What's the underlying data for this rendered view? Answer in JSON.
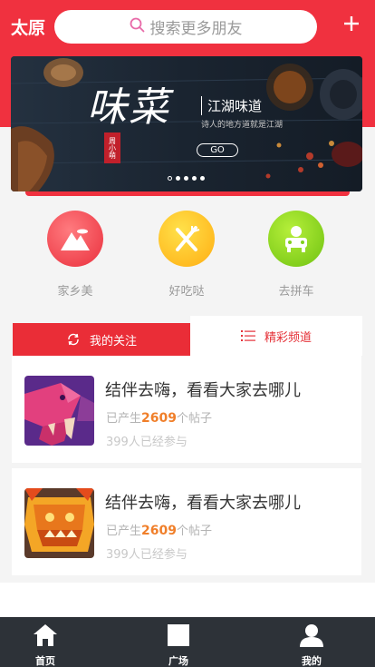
{
  "header": {
    "city": "太原",
    "search_placeholder": "搜索更多朋友"
  },
  "banner": {
    "title": "味菜",
    "seal": "周小萌",
    "subtitle": "江湖味道",
    "tagline": "诗人的地方道就是江湖",
    "button": "GO",
    "slide_count": 5,
    "active_slide": 2
  },
  "categories": [
    {
      "label": "家乡美",
      "icon": "mountain-icon",
      "color": "#f04752"
    },
    {
      "label": "好吃哒",
      "icon": "fork-knife-icon",
      "color": "#ffbe1f"
    },
    {
      "label": "去拼车",
      "icon": "car-icon",
      "color": "#7fd11b"
    }
  ],
  "tabs": {
    "following": "我的关注",
    "featured": "精彩频道"
  },
  "cards": [
    {
      "title": "结伴去嗨，看看大家去哪儿",
      "posts_prefix": "已产生",
      "posts_count": "2609",
      "posts_suffix": "个帖子",
      "participants": "399人已经参与"
    },
    {
      "title": "结伴去嗨，看看大家去哪儿",
      "posts_prefix": "已产生",
      "posts_count": "2609",
      "posts_suffix": "个帖子",
      "participants": "399人已经参与"
    }
  ],
  "bottom_nav": [
    {
      "label": "首页",
      "icon": "home-icon"
    },
    {
      "label": "广场",
      "icon": "square-icon"
    },
    {
      "label": "我的",
      "icon": "user-icon"
    }
  ],
  "colors": {
    "brand_red": "#f0313f",
    "accent_orange": "#f07f2a",
    "nav_bg": "#2d3238"
  }
}
